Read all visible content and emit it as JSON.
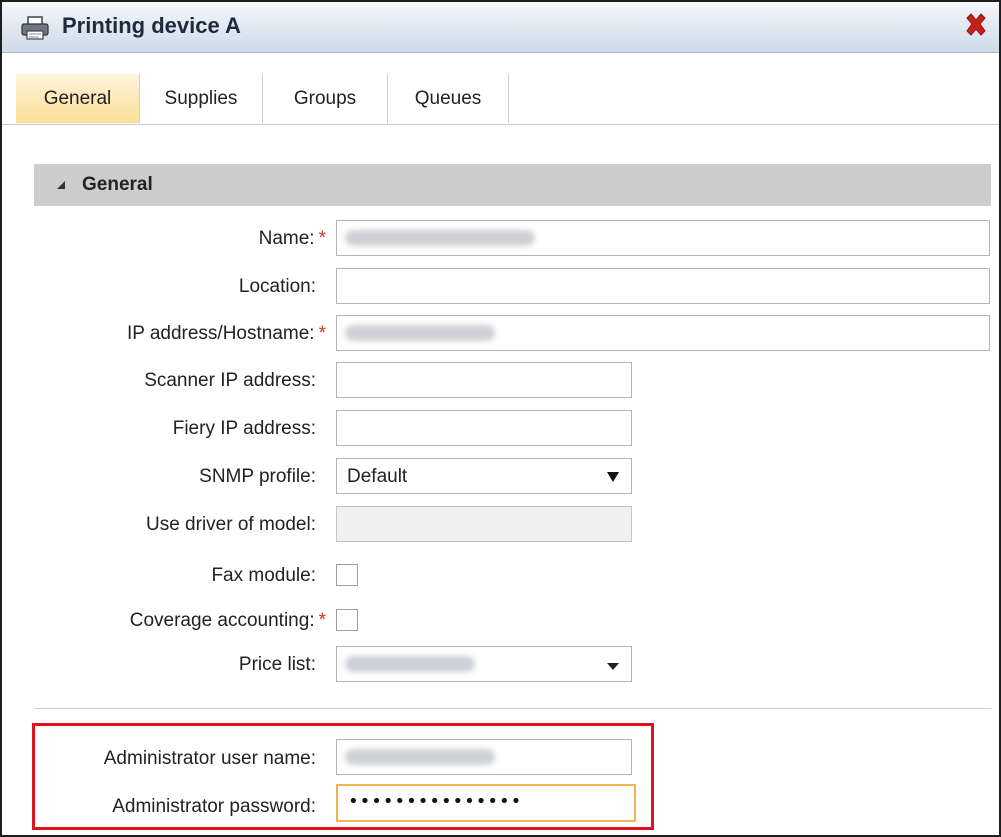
{
  "window": {
    "title": "Printing device A",
    "icon": "printer-icon",
    "close_icon": "close-icon"
  },
  "tabs": [
    {
      "label": "General",
      "active": true
    },
    {
      "label": "Supplies",
      "active": false
    },
    {
      "label": "Groups",
      "active": false
    },
    {
      "label": "Queues",
      "active": false
    }
  ],
  "section": {
    "title": "General",
    "icon": "collapse-triangle-icon"
  },
  "form": {
    "name_label": "Name:",
    "location_label": "Location:",
    "ip_label": "IP address/Hostname:",
    "scanner_ip_label": "Scanner IP address:",
    "fiery_ip_label": "Fiery IP address:",
    "snmp_label": "SNMP profile:",
    "snmp_value": "Default",
    "driver_label": "Use driver of model:",
    "fax_label": "Fax module:",
    "coverage_label": "Coverage accounting:",
    "price_list_label": "Price list:",
    "admin_user_label": "Administrator user name:",
    "admin_password_label": "Administrator password:",
    "admin_password_value": "•••••••••••••••",
    "required_mark": "*",
    "fax_checked": false,
    "coverage_checked": false
  },
  "colors": {
    "active_tab": "#fbdf97",
    "highlight_border": "#e0131d",
    "required": "#d9332b",
    "focus_border": "#f0b64d"
  }
}
